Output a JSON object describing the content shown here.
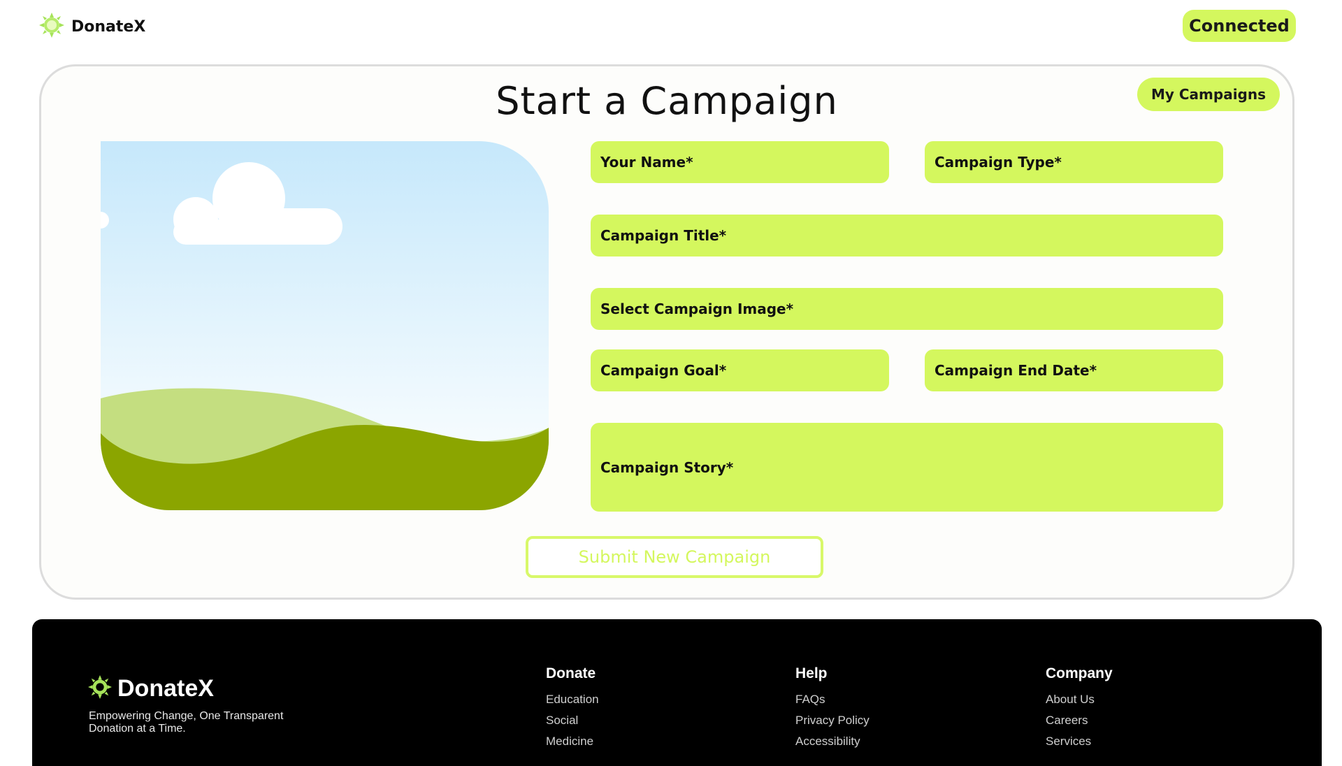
{
  "header": {
    "brand": "DonateX",
    "brand_icon": "sun-gear-icon",
    "connected_label": "Connected"
  },
  "main": {
    "title": "Start a Campaign",
    "my_campaigns_label": "My Campaigns",
    "preview_image": "landscape-placeholder",
    "fields": {
      "your_name": "Your Name*",
      "campaign_type": "Campaign Type*",
      "campaign_title": "Campaign Title*",
      "campaign_image": "Select Campaign Image*",
      "campaign_goal": "Campaign Goal*",
      "campaign_end_date": "Campaign End Date*",
      "campaign_story": "Campaign Story*"
    },
    "submit_label": "Submit New Campaign"
  },
  "footer": {
    "brand": "DonateX",
    "tagline": "Empowering Change, One Transparent Donation at a Time.",
    "columns": [
      {
        "heading": "Donate",
        "links": [
          "Education",
          "Social",
          "Medicine"
        ]
      },
      {
        "heading": "Help",
        "links": [
          "FAQs",
          "Privacy Policy",
          "Accessibility"
        ]
      },
      {
        "heading": "Company",
        "links": [
          "About Us",
          "Careers",
          "Services"
        ]
      }
    ]
  },
  "colors": {
    "accent": "#d4f75e",
    "footer_bg": "#000000",
    "card_border": "#dcdcdc"
  }
}
